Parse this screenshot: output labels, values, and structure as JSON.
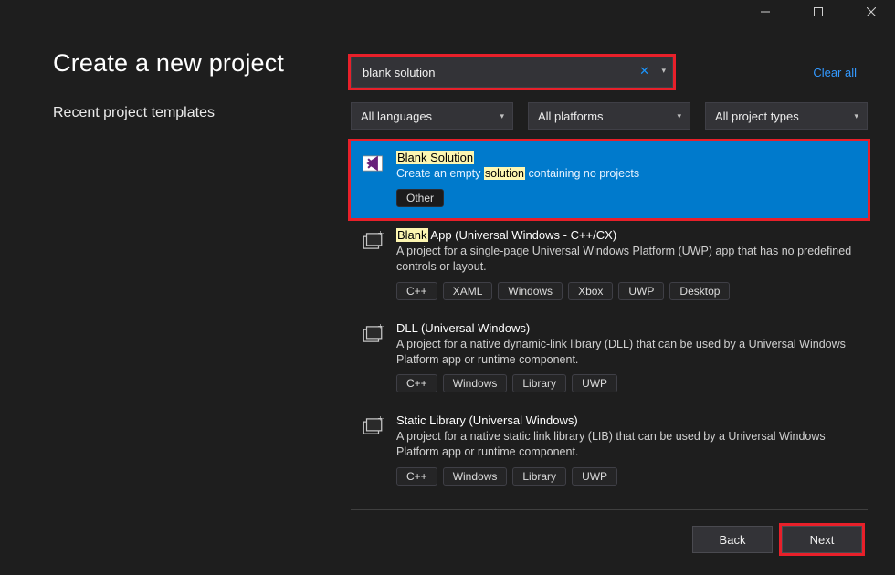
{
  "window": {
    "title": "Create a new project",
    "recent_heading": "Recent project templates"
  },
  "search": {
    "value": "blank solution",
    "clear_all": "Clear all"
  },
  "filters": {
    "languages": "All languages",
    "platforms": "All platforms",
    "types": "All project types"
  },
  "results": [
    {
      "title_pre": "",
      "title_hl": "Blank Solution",
      "title_post": "",
      "desc_pre": "Create an empty ",
      "desc_hl": "solution",
      "desc_post": " containing no projects",
      "tags": [
        "Other"
      ],
      "selected": true,
      "icon": "vs"
    },
    {
      "title_pre": "",
      "title_hl": "Blank",
      "title_post": " App (Universal Windows - C++/CX)",
      "desc_pre": "A project for a single-page Universal Windows Platform (UWP) app that has no predefined controls or layout.",
      "desc_hl": "",
      "desc_post": "",
      "tags": [
        "C++",
        "XAML",
        "Windows",
        "Xbox",
        "UWP",
        "Desktop"
      ],
      "selected": false,
      "icon": "box"
    },
    {
      "title_pre": "DLL (Universal Windows)",
      "title_hl": "",
      "title_post": "",
      "desc_pre": "A project for a native dynamic-link library (DLL) that can be used by a Universal Windows Platform app or runtime component.",
      "desc_hl": "",
      "desc_post": "",
      "tags": [
        "C++",
        "Windows",
        "Library",
        "UWP"
      ],
      "selected": false,
      "icon": "box"
    },
    {
      "title_pre": "Static Library (Universal Windows)",
      "title_hl": "",
      "title_post": "",
      "desc_pre": "A project for a native static link library (LIB) that can be used by a Universal Windows Platform app or runtime component.",
      "desc_hl": "",
      "desc_post": "",
      "tags": [
        "C++",
        "Windows",
        "Library",
        "UWP"
      ],
      "selected": false,
      "icon": "box"
    }
  ],
  "buttons": {
    "back": "Back",
    "next": "Next"
  }
}
